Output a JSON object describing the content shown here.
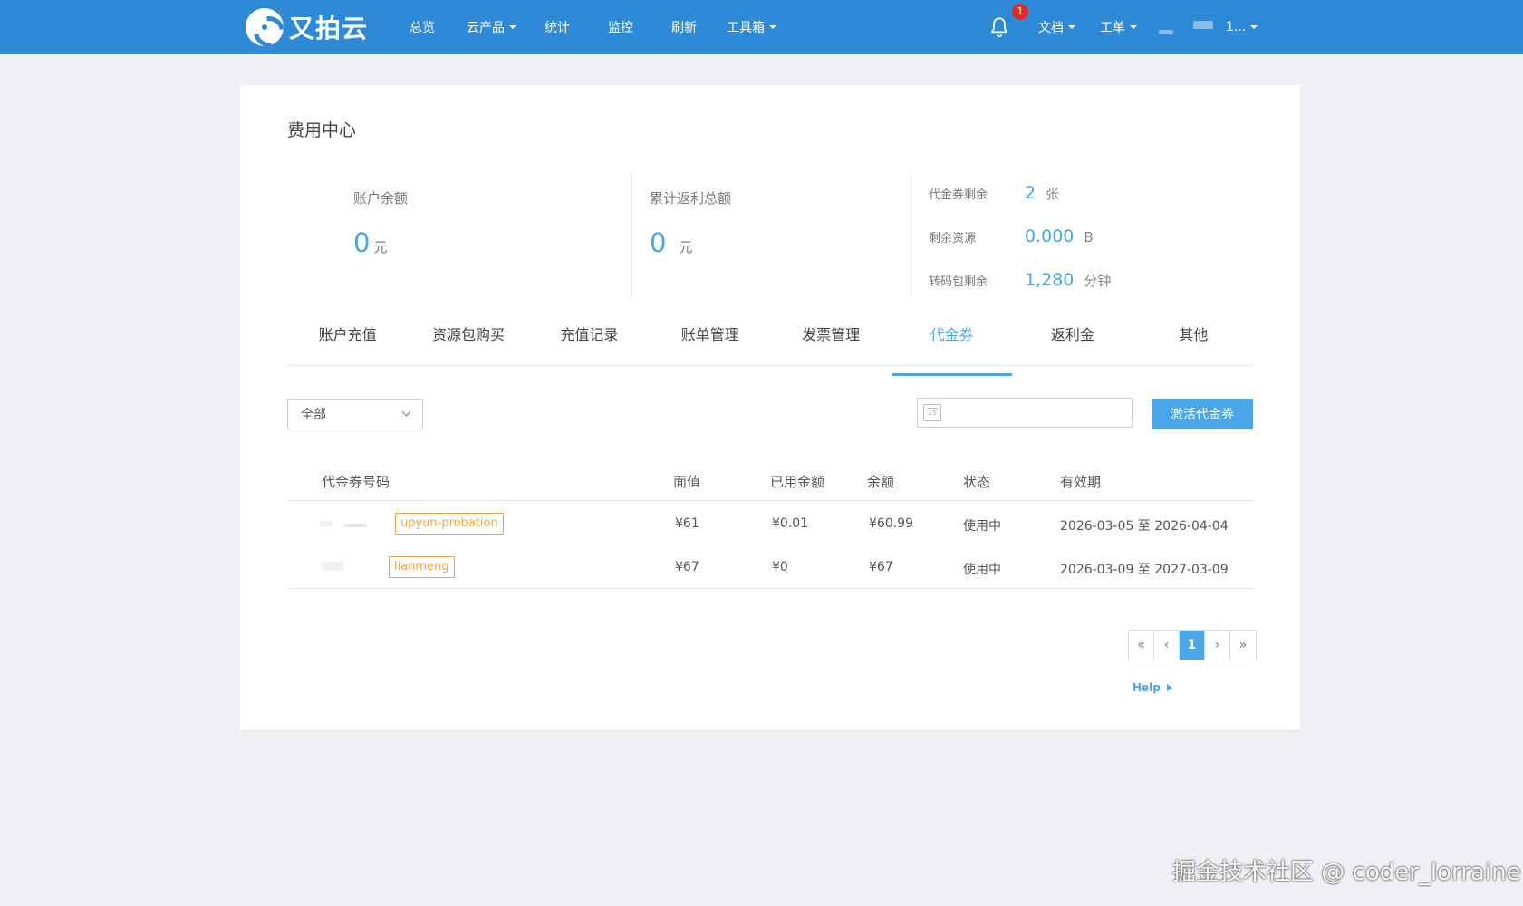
{
  "header": {
    "brand": "又拍云",
    "nav": [
      "总览",
      "云产品",
      "统计",
      "监控",
      "刷新",
      "工具箱"
    ],
    "notification_count": "1",
    "right": [
      "文档",
      "工单"
    ],
    "user_tail": "1..."
  },
  "page": {
    "title": "费用中心"
  },
  "summary": {
    "balance": {
      "label": "账户余额",
      "value": "0",
      "unit": "元"
    },
    "rebate": {
      "label": "累计返利总额",
      "value": "0",
      "unit": "元"
    },
    "resources": [
      {
        "label": "代金券剩余",
        "value": "2",
        "unit": "张"
      },
      {
        "label": "剩余资源",
        "value": "0.000",
        "unit": "B"
      },
      {
        "label": "转码包剩余",
        "value": "1,280",
        "unit": "分钟"
      }
    ]
  },
  "tabs": {
    "items": [
      "账户充值",
      "资源包购买",
      "充值记录",
      "账单管理",
      "发票管理",
      "代金券",
      "返利金",
      "其他"
    ],
    "active": "代金券"
  },
  "filters": {
    "status_select": "全部",
    "calendar_icon_text": "15",
    "activate_button": "激活代金券"
  },
  "table": {
    "headers": [
      "代金券号码",
      "面值",
      "已用金额",
      "余额",
      "状态",
      "有效期"
    ],
    "rows": [
      {
        "code_tag": "upyun-probation",
        "face": "¥61",
        "used": "¥0.01",
        "balance": "¥60.99",
        "status": "使用中",
        "validity": "2026-03-05 至 2026-04-04"
      },
      {
        "code_tag": "lianmeng",
        "face": "¥67",
        "used": "¥0",
        "balance": "¥67",
        "status": "使用中",
        "validity": "2026-03-09 至 2027-03-09"
      }
    ]
  },
  "pagination": {
    "first": "«",
    "prev": "‹",
    "current": "1",
    "next": "›",
    "last": "»"
  },
  "help": {
    "label": "Help"
  },
  "watermark": "掘金技术社区 @ coder_lorraine",
  "colors": {
    "topbar": "#2e8ad6",
    "accent": "#49a6e9",
    "tag": "#f0a54a",
    "badge": "#e02b2b"
  }
}
